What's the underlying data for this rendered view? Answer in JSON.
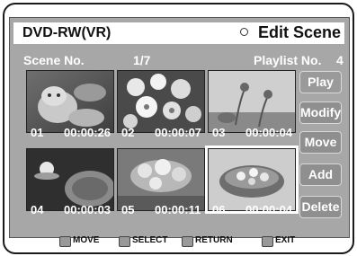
{
  "header": {
    "app_title": "DVD-RW(VR)",
    "screen_title": "Edit Scene"
  },
  "info": {
    "scene_label": "Scene No.",
    "scene_value": "1/7",
    "playlist_label": "Playlist No.",
    "playlist_value": "4"
  },
  "scenes": [
    {
      "num": "01",
      "time": "00:00:26",
      "icon": "kitten-photo"
    },
    {
      "num": "02",
      "time": "00:00:07",
      "icon": "white-flowers-photo"
    },
    {
      "num": "03",
      "time": "00:00:04",
      "icon": "flower-stems-photo"
    },
    {
      "num": "04",
      "time": "00:00:03",
      "icon": "lotus-leaf-photo"
    },
    {
      "num": "05",
      "time": "00:00:11",
      "icon": "blossom-photo"
    },
    {
      "num": "06",
      "time": "00:00:04",
      "icon": "flower-bowl-photo"
    }
  ],
  "selected_scene": "06",
  "buttons": {
    "play": "Play",
    "modify": "Modify",
    "move": "Move",
    "add": "Add",
    "delete": "Delete"
  },
  "help": {
    "move": "MOVE",
    "select": "SELECT",
    "return": "RETURN",
    "exit": "EXIT"
  },
  "colors": {
    "panel": "#a7a7a7",
    "button": "#8f8f8f",
    "text": "#ffffff"
  }
}
